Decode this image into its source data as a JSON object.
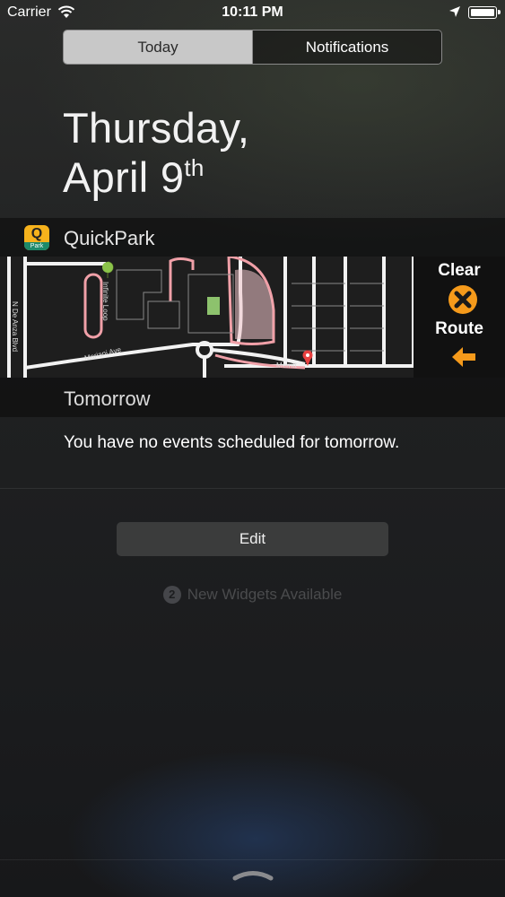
{
  "status_bar": {
    "carrier": "Carrier",
    "time": "10:11 PM",
    "icons": [
      "wifi-icon",
      "location-arrow-icon",
      "battery-icon"
    ]
  },
  "segmented_control": {
    "tabs": [
      {
        "label": "Today",
        "selected": true
      },
      {
        "label": "Notifications",
        "selected": false
      }
    ]
  },
  "date": {
    "line1": "Thursday,",
    "line2": "April 9",
    "suffix": "th"
  },
  "quickpark": {
    "app_name": "QuickPark",
    "icon_letter": "Q",
    "icon_caption": "Park",
    "map": {
      "street_labels": [
        "Mariani Ave",
        "Merritt",
        "N De Anza Blvd",
        "Infinite Loop"
      ],
      "pin_colors": {
        "destination": "#e84040",
        "start": "#8bc34a"
      }
    },
    "controls": {
      "clear_label": "Clear",
      "route_label": "Route",
      "accent_color": "#f59a1b"
    }
  },
  "tomorrow": {
    "title": "Tomorrow",
    "message": "You have no events scheduled for tomorrow."
  },
  "edit_button": "Edit",
  "new_widgets": {
    "count": "2",
    "label": "New Widgets Available"
  }
}
